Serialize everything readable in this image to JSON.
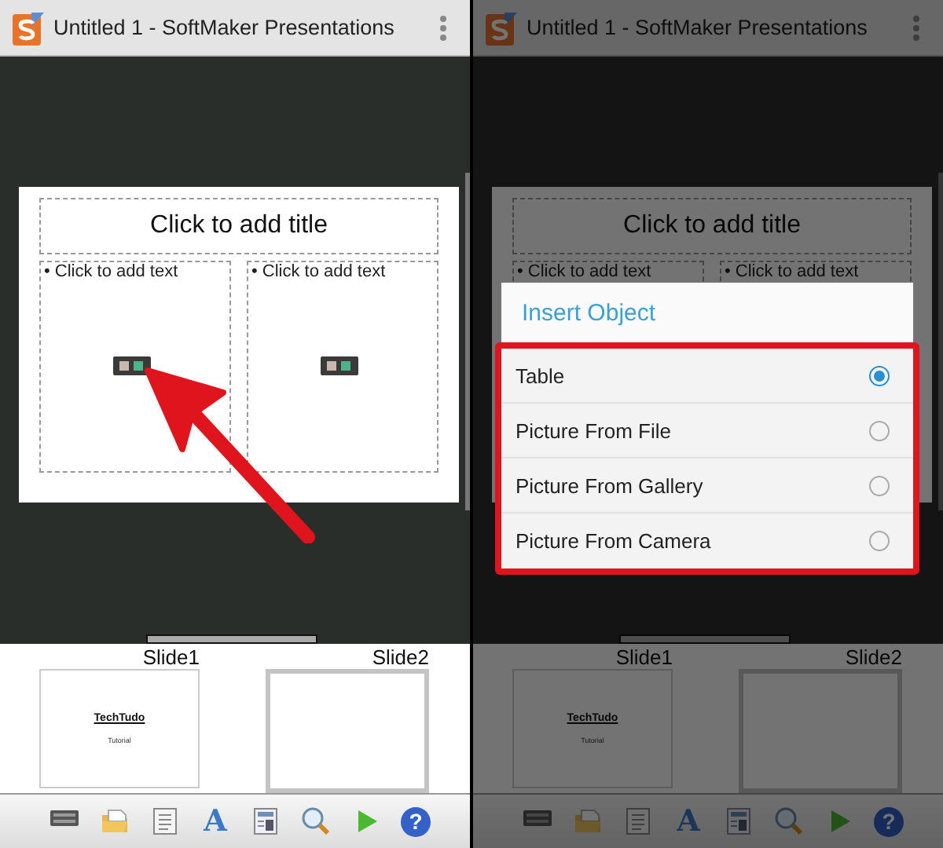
{
  "panels": [
    {
      "title": "Untitled 1 - SoftMaker Presentations",
      "dimmed": false,
      "slide": {
        "title": "Click to add title",
        "placeholders": [
          "• Click to add text",
          "• Click to add text"
        ]
      },
      "thumbnails": [
        {
          "label": "Slide1",
          "title": "TechTudo",
          "subtitle": "Tutorial",
          "selected": false
        },
        {
          "label": "Slide2",
          "selected": true
        }
      ],
      "toolbar": [
        {
          "kind": "keyboard"
        },
        {
          "kind": "folder"
        },
        {
          "kind": "document"
        },
        {
          "kind": "text-style",
          "glyph": "A"
        },
        {
          "kind": "layout"
        },
        {
          "kind": "search"
        },
        {
          "kind": "play"
        },
        {
          "kind": "help",
          "glyph": "?"
        }
      ],
      "annotation": {
        "kind": "arrow"
      }
    },
    {
      "title": "Untitled 1 - SoftMaker Presentations",
      "dimmed": true,
      "slide": {
        "title": "Click to add title",
        "placeholders": [
          "• Click to add text",
          "• Click to add text"
        ]
      },
      "thumbnails": [
        {
          "label": "Slide1",
          "title": "TechTudo",
          "subtitle": "Tutorial",
          "selected": false
        },
        {
          "label": "Slide2",
          "selected": true
        }
      ],
      "toolbar": [
        {
          "kind": "keyboard"
        },
        {
          "kind": "folder"
        },
        {
          "kind": "document"
        },
        {
          "kind": "text-style",
          "glyph": "A"
        },
        {
          "kind": "layout"
        },
        {
          "kind": "search"
        },
        {
          "kind": "play"
        },
        {
          "kind": "help",
          "glyph": "?"
        }
      ],
      "dialog": {
        "title": "Insert Object",
        "options": [
          {
            "label": "Table",
            "selected": true
          },
          {
            "label": "Picture From File",
            "selected": false
          },
          {
            "label": "Picture From Gallery",
            "selected": false
          },
          {
            "label": "Picture From Camera",
            "selected": false
          }
        ]
      },
      "annotation": {
        "kind": "highlight"
      }
    }
  ]
}
